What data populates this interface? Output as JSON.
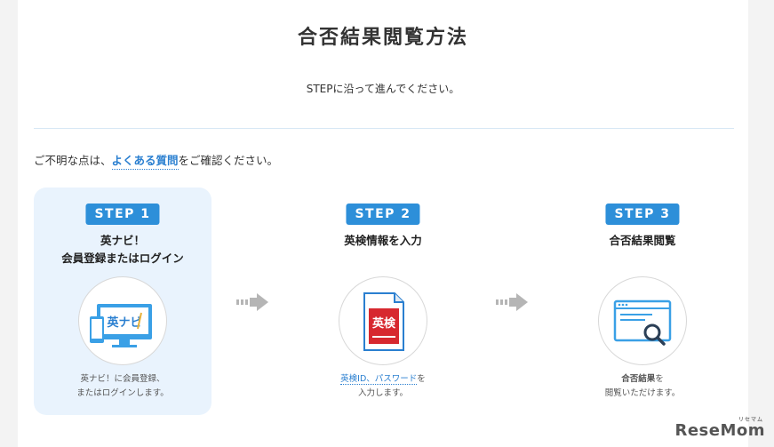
{
  "header": {
    "title": "合否結果閲覧方法",
    "subtitle": "STEPに沿って進んでください。"
  },
  "help": {
    "prefix": "ご不明な点は、",
    "link": "よくある質問",
    "suffix": "をご確認ください。"
  },
  "steps": [
    {
      "badge": "STEP 1",
      "title_line1": "英ナビ！",
      "title_line2": "会員登録またはログイン",
      "icon": "device-icon",
      "icon_text": "英ナビ",
      "desc_line1": "英ナビ！に会員登録、",
      "desc_line2": "またはログインします。"
    },
    {
      "badge": "STEP 2",
      "title_line1": "英検情報を入力",
      "icon": "document-icon",
      "icon_text": "英検",
      "desc_link": "英検ID、パスワード",
      "desc_suffix": "を",
      "desc_line2": "入力します。"
    },
    {
      "badge": "STEP 3",
      "title_line1": "合否結果閲覧",
      "icon": "browser-search-icon",
      "desc_bold": "合否結果",
      "desc_suffix": "を",
      "desc_line2": "閲覧いただけます。"
    }
  ],
  "brand": {
    "logo": "ReseMom",
    "sub": "リセマム"
  },
  "colors": {
    "accent": "#2d8fd9",
    "link": "#2a7fd0",
    "active_bg": "#e9f3fd",
    "eiken_red": "#d7282f"
  }
}
